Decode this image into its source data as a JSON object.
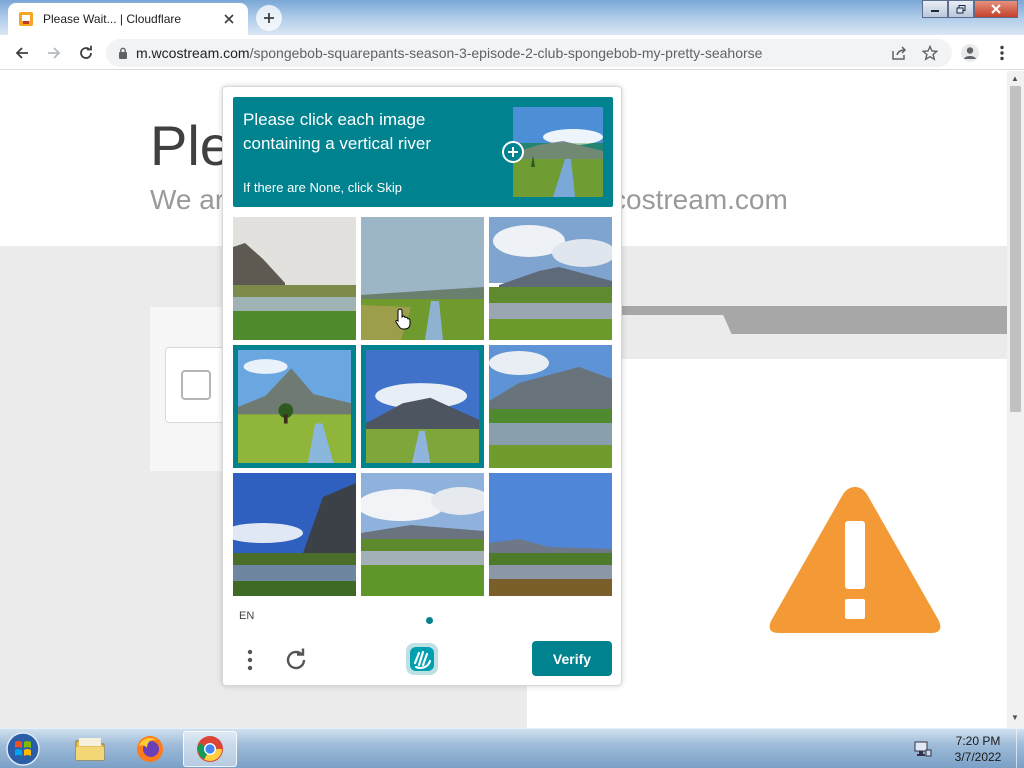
{
  "browser": {
    "tab": {
      "title": "Please Wait... | Cloudflare"
    },
    "address_bar": {
      "url_host": "m.wcostream.com",
      "url_path": "/spongebob-squarepants-season-3-episode-2-club-spongebob-my-pretty-seahorse"
    }
  },
  "page": {
    "title": "Ple",
    "subtitle": "We ar",
    "domain_fragment": "costream.com"
  },
  "captcha": {
    "prompt": "Please click each image containing a vertical river",
    "hint": "If there are None, click Skip",
    "language": "EN",
    "verify_label": "Verify",
    "accent_color": "#00838f",
    "selected_tiles": [
      4,
      5
    ]
  },
  "taskbar": {
    "apps": [
      "windows-explorer",
      "firefox",
      "chrome"
    ],
    "time": "7:20 PM",
    "date": "3/7/2022"
  }
}
